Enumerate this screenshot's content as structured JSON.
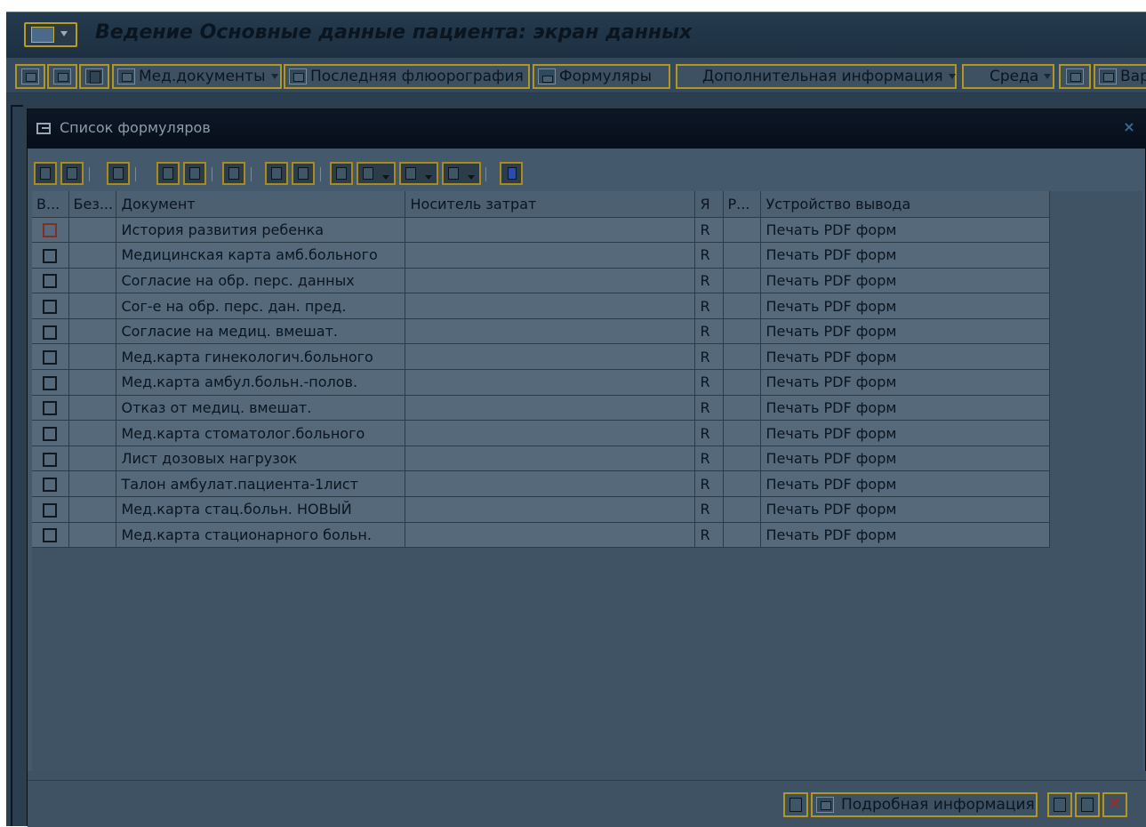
{
  "app": {
    "title": "Ведение Основные данные пациента: экран данных"
  },
  "app_toolbar": {
    "med_docs_label": "Мед.документы",
    "last_fluoro_label": "Последняя флюорография",
    "forms_label": "Формуляры",
    "additional_info_label": "Дополнительная информация",
    "environment_label": "Среда",
    "variants_label": "Вар"
  },
  "dialog": {
    "title": "Список формуляров",
    "close_glyph": "×",
    "columns": {
      "select": "В...",
      "without": "Без...",
      "document": "Документ",
      "cost_carrier": "Носитель затрат",
      "lang": "Я",
      "p": "Р...",
      "output_device": "Устройство вывода"
    },
    "rows": [
      {
        "document": "История развития ребенка",
        "lang": "R",
        "device": "Печать PDF форм",
        "checked": false
      },
      {
        "document": "Медицинская карта амб.больного",
        "lang": "R",
        "device": "Печать PDF форм",
        "checked": false
      },
      {
        "document": "Согласие на обр. перс. данных",
        "lang": "R",
        "device": "Печать PDF форм",
        "checked": false
      },
      {
        "document": "Сог-е на обр. перс. дан. пред.",
        "lang": "R",
        "device": "Печать PDF форм",
        "checked": false
      },
      {
        "document": "Согласие на медиц. вмешат.",
        "lang": "R",
        "device": "Печать PDF форм",
        "checked": false
      },
      {
        "document": "Мед.карта гинекологич.больного",
        "lang": "R",
        "device": "Печать PDF форм",
        "checked": false
      },
      {
        "document": "Мед.карта амбул.больн.-полов.",
        "lang": "R",
        "device": "Печать PDF форм",
        "checked": false
      },
      {
        "document": "Отказ от медиц. вмешат.",
        "lang": "R",
        "device": "Печать PDF форм",
        "checked": false
      },
      {
        "document": "Мед.карта стоматолог.больного",
        "lang": "R",
        "device": "Печать PDF форм",
        "checked": false
      },
      {
        "document": "Лист дозовых нагрузок",
        "lang": "R",
        "device": "Печать PDF форм",
        "checked": false
      },
      {
        "document": "Талон амбулат.пациента-1лист",
        "lang": "R",
        "device": "Печать PDF форм",
        "checked": false
      },
      {
        "document": "Мед.карта стац.больн. НОВЫЙ",
        "lang": "R",
        "device": "Печать PDF форм",
        "checked": false
      },
      {
        "document": "Мед.карта стационарного больн.",
        "lang": "R",
        "device": "Печать PDF форм",
        "checked": false
      }
    ],
    "footer": {
      "detail_label": "Подробная информация"
    }
  },
  "colors": {
    "toolbar_button_border": "#b39620",
    "dialog_title_bg": "#0c1726",
    "grid_cell_bg": "#55697a",
    "cancel_icon": "#a52a1e"
  }
}
